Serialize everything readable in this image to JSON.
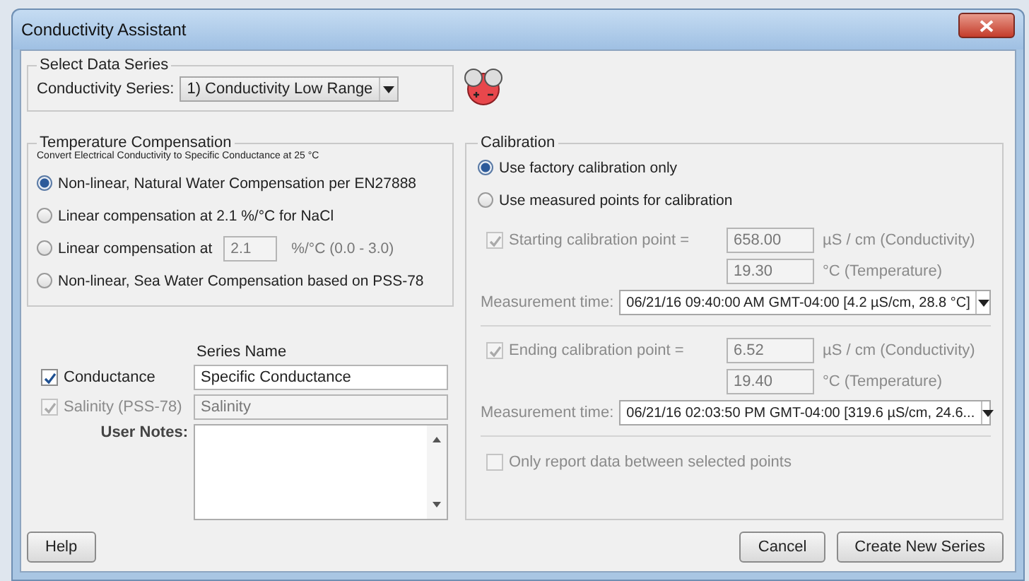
{
  "window": {
    "title": "Conductivity Assistant"
  },
  "select_data_series": {
    "legend": "Select Data Series",
    "label": "Conductivity Series:",
    "value": "1) Conductivity Low Range"
  },
  "temperature_compensation": {
    "legend": "Temperature Compensation",
    "description": "Convert Electrical Conductivity to Specific Conductance at 25 °C",
    "options": [
      {
        "kind": "plain",
        "label": "Non-linear, Natural Water Compensation per EN27888",
        "selected": true
      },
      {
        "kind": "plain",
        "label": "Linear compensation at 2.1 %/°C for NaCl",
        "selected": false
      },
      {
        "kind": "input",
        "label": "Linear compensation at",
        "value": "2.1",
        "unit": "%/°C  (0.0 - 3.0)",
        "selected": false
      },
      {
        "kind": "plain",
        "label": "Non-linear, Sea Water Compensation based on PSS-78",
        "selected": false
      }
    ]
  },
  "series": {
    "heading": "Series Name",
    "rows": [
      {
        "label": "Conductance",
        "checked": true,
        "disabled": false,
        "name": "Specific Conductance"
      },
      {
        "label": "Salinity (PSS-78)",
        "checked": true,
        "disabled": true,
        "name": "Salinity"
      }
    ],
    "notes_label": "User Notes:"
  },
  "calibration": {
    "legend": "Calibration",
    "modes": [
      {
        "label": "Use factory calibration only",
        "selected": true
      },
      {
        "label": "Use measured points for calibration",
        "selected": false
      }
    ],
    "points": [
      {
        "label": "Starting calibration point =",
        "checked": true,
        "disabled": true,
        "conductivity": "658.00",
        "conductivity_unit": "µS / cm (Conductivity)",
        "temperature": "19.30",
        "temperature_unit": "°C (Temperature)",
        "time_label": "Measurement time:",
        "time": "06/21/16 09:40:00 AM GMT-04:00 [4.2 µS/cm, 28.8 °C]"
      },
      {
        "label": "Ending calibration point =",
        "checked": true,
        "disabled": true,
        "conductivity": "6.52",
        "conductivity_unit": "µS / cm (Conductivity)",
        "temperature": "19.40",
        "temperature_unit": "°C (Temperature)",
        "time_label": "Measurement time:",
        "time": "06/21/16 02:03:50 PM GMT-04:00 [319.6 µS/cm, 24.6..."
      }
    ],
    "only_between": {
      "label": "Only report data between selected points",
      "checked": false,
      "disabled": true
    }
  },
  "buttons": [
    {
      "kind": "help",
      "label": "Help"
    },
    {
      "kind": "action",
      "label": "Cancel"
    },
    {
      "kind": "action",
      "label": "Create New Series"
    }
  ]
}
